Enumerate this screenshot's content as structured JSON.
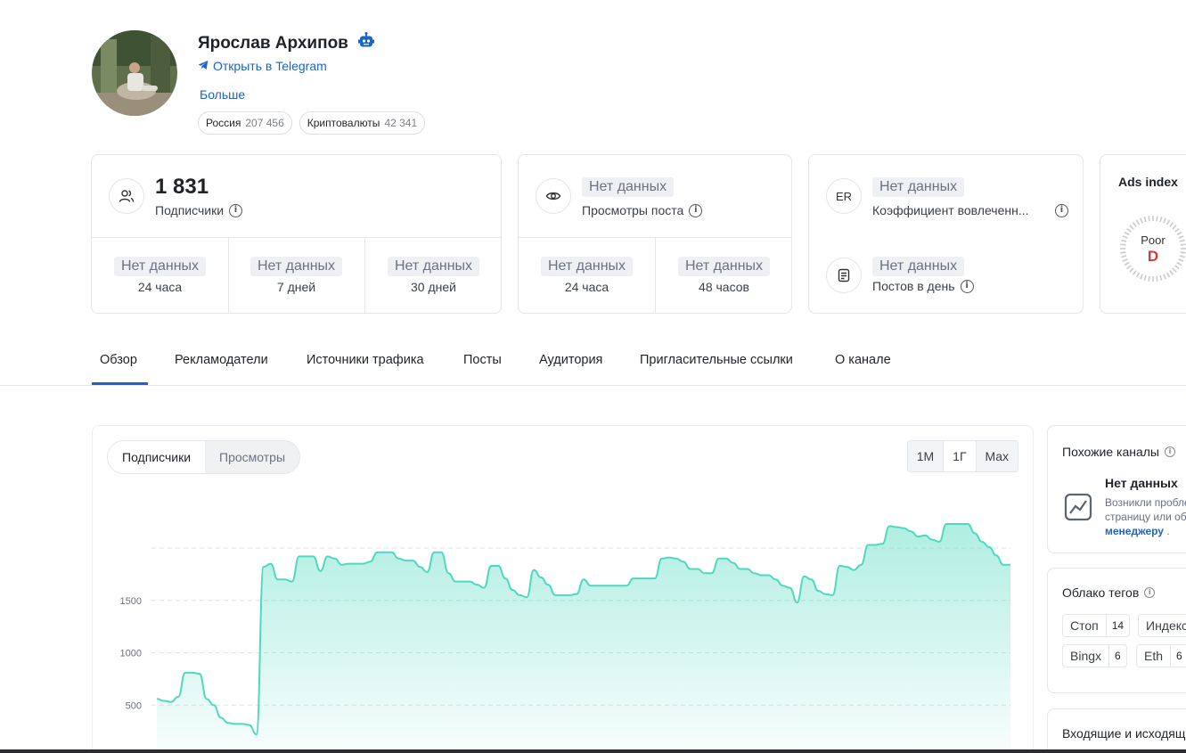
{
  "profile": {
    "name": "Ярослав Архипов",
    "telegram_link": "Открыть в Telegram",
    "more_link": "Больше",
    "chips": [
      {
        "label": "Россия",
        "count": "207 456"
      },
      {
        "label": "Криптовалюты",
        "count": "42 341"
      }
    ]
  },
  "subscribers_card": {
    "value": "1 831",
    "label": "Подписчики",
    "cells": [
      {
        "value": "Нет данных",
        "period": "24 часа"
      },
      {
        "value": "Нет данных",
        "period": "7 дней"
      },
      {
        "value": "Нет данных",
        "period": "30 дней"
      }
    ]
  },
  "views_card": {
    "value": "Нет данных",
    "label": "Просмотры поста",
    "cells": [
      {
        "value": "Нет данных",
        "period": "24 часа"
      },
      {
        "value": "Нет данных",
        "period": "48 часов"
      }
    ]
  },
  "er_card": {
    "icon_text": "ER",
    "value": "Нет данных",
    "label": "Коэффициент вовлеченн...",
    "posts_value": "Нет данных",
    "posts_label": "Постов в день"
  },
  "ads_card": {
    "title": "Ads index",
    "rating": "Poor",
    "grade": "D",
    "grade_color": "#d23b3b"
  },
  "tabs": [
    "Обзор",
    "Рекламодатели",
    "Источники трафика",
    "Посты",
    "Аудитория",
    "Пригласительные ссылки",
    "О канале"
  ],
  "active_tab": "Обзор",
  "chart_controls": {
    "metric_tabs": [
      "Подписчики",
      "Просмотры"
    ],
    "active_metric": "Подписчики",
    "ranges": [
      "1М",
      "1Г",
      "Max"
    ],
    "active_range": "1Г"
  },
  "chart_data": {
    "type": "area",
    "series_color": "#4fd9bf",
    "y_ticks": [
      "1500",
      "1000",
      "500"
    ],
    "y_tick_values": [
      1500,
      1000,
      500
    ],
    "ylim": [
      0,
      2300
    ],
    "grid": true,
    "values": [
      560,
      540,
      530,
      580,
      810,
      810,
      800,
      560,
      500,
      380,
      330,
      320,
      320,
      310,
      220,
      1820,
      1850,
      1700,
      1700,
      1680,
      1920,
      1920,
      1920,
      1780,
      1920,
      1900,
      1840,
      1850,
      1850,
      1850,
      1870,
      1960,
      1960,
      1960,
      1900,
      1880,
      1880,
      1820,
      1770,
      1960,
      1960,
      1760,
      1680,
      1680,
      1680,
      1650,
      1620,
      1830,
      1830,
      1710,
      1600,
      1550,
      1530,
      1790,
      1720,
      1650,
      1550,
      1550,
      1550,
      1560,
      1700,
      1640,
      1640,
      1640,
      1640,
      1640,
      1640,
      1710,
      1710,
      1710,
      1710,
      1900,
      1910,
      1900,
      1870,
      1800,
      1800,
      1760,
      1760,
      1900,
      1900,
      1860,
      1800,
      1800,
      1760,
      1740,
      1740,
      1700,
      1640,
      1620,
      1480,
      1730,
      1700,
      1590,
      1560,
      1550,
      1830,
      1820,
      1790,
      1840,
      2030,
      2030,
      2040,
      2210,
      2200,
      2190,
      2160,
      2110,
      2120,
      2080,
      2060,
      2230,
      2230,
      2230,
      2230,
      2140,
      2060,
      2010,
      1930,
      1840,
      1840
    ]
  },
  "similar_channels": {
    "title": "Похожие каналы",
    "empty_title": "Нет данных",
    "desc_line1": "Возникли проблемы, обновите",
    "desc_line2": "страницу или обратитесь к",
    "desc_link": "менеджеру",
    "desc_end": "."
  },
  "tag_cloud": {
    "title": "Облако тегов",
    "tags": [
      {
        "name": "Стоп",
        "count": "14"
      },
      {
        "name": "Индекс",
        "count": ""
      },
      {
        "name": "Bingx",
        "count": "6"
      },
      {
        "name": "Eth",
        "count": "6"
      }
    ]
  },
  "inout": {
    "title": "Входящие и исходящие"
  }
}
